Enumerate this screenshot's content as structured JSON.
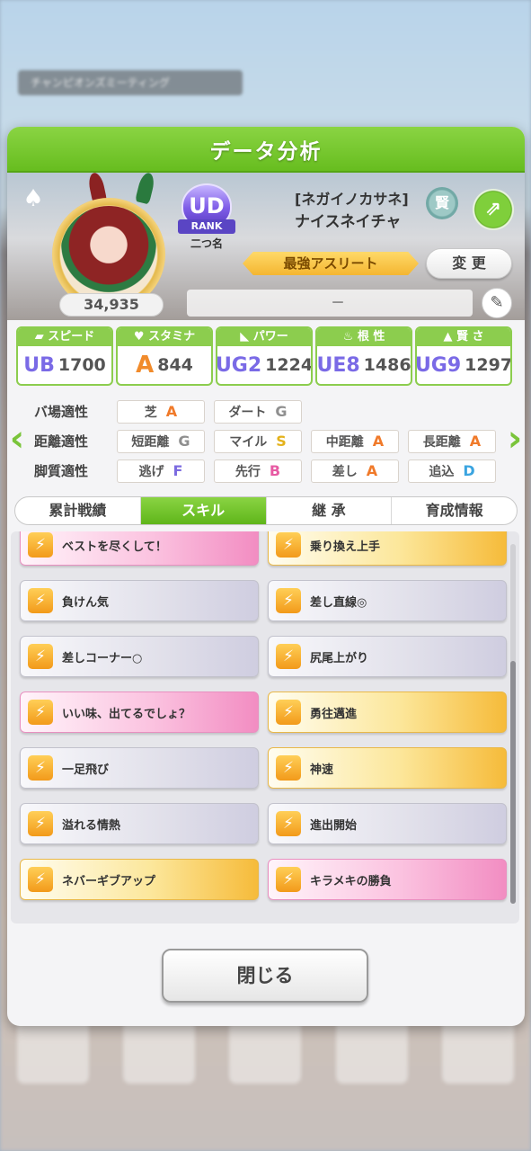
{
  "background": {
    "banner_text": "チャンピオンズミーティング"
  },
  "dialog": {
    "title": "データ分析",
    "close_label": "閉じる"
  },
  "profile": {
    "fans": "34,935",
    "rank_badge": "UD",
    "rank_label": "RANK",
    "rank_name": "二つ名",
    "epithet": "[ネガイノカサネ]",
    "name": "ナイスネイチャ",
    "title_token": "賢",
    "athlete_title": "最強アスリート",
    "change_label": "変 更",
    "comment": "－"
  },
  "stats": [
    {
      "label": "スピード",
      "icon": "shoe-icon",
      "grade": "UB",
      "value": "1700"
    },
    {
      "label": "スタミナ",
      "icon": "heart-icon",
      "grade": "A",
      "value": "844"
    },
    {
      "label": "パワー",
      "icon": "muscle-icon",
      "grade": "UG2",
      "value": "1224"
    },
    {
      "label": "根 性",
      "icon": "flame-icon",
      "grade": "UE8",
      "value": "1486"
    },
    {
      "label": "賢 さ",
      "icon": "mortarboard-icon",
      "grade": "UG9",
      "value": "1297"
    }
  ],
  "aptitude": {
    "track_label": "バ場適性",
    "distance_label": "距離適性",
    "style_label": "脚質適性",
    "track": [
      {
        "name": "芝",
        "grade": "A"
      },
      {
        "name": "ダート",
        "grade": "G"
      }
    ],
    "distance": [
      {
        "name": "短距離",
        "grade": "G"
      },
      {
        "name": "マイル",
        "grade": "S"
      },
      {
        "name": "中距離",
        "grade": "A"
      },
      {
        "name": "長距離",
        "grade": "A"
      }
    ],
    "style": [
      {
        "name": "逃げ",
        "grade": "F"
      },
      {
        "name": "先行",
        "grade": "B"
      },
      {
        "name": "差し",
        "grade": "A"
      },
      {
        "name": "追込",
        "grade": "D"
      }
    ]
  },
  "tabs": [
    "累計戦績",
    "スキル",
    "継 承",
    "育成情報"
  ],
  "active_tab": "スキル",
  "skills": [
    {
      "name": "ベストを尽くして！",
      "rarity": "pink"
    },
    {
      "name": "乗り換え上手",
      "rarity": "gold"
    },
    {
      "name": "負けん気",
      "rarity": "normal"
    },
    {
      "name": "差し直線◎",
      "rarity": "normal"
    },
    {
      "name": "差しコーナー○",
      "rarity": "normal"
    },
    {
      "name": "尻尾上がり",
      "rarity": "normal"
    },
    {
      "name": "いい味、出てるでしょ？",
      "rarity": "pink"
    },
    {
      "name": "勇往邁進",
      "rarity": "gold"
    },
    {
      "name": "一足飛び",
      "rarity": "normal"
    },
    {
      "name": "神速",
      "rarity": "gold"
    },
    {
      "name": "溢れる情熱",
      "rarity": "normal"
    },
    {
      "name": "進出開始",
      "rarity": "normal"
    },
    {
      "name": "ネバーギブアップ",
      "rarity": "gold"
    },
    {
      "name": "キラメキの勝負",
      "rarity": "pink"
    }
  ],
  "colors": {
    "accent_green": "#6cc124",
    "gold_skill": "#f6bb3a",
    "pink_skill": "#f28dc2"
  }
}
